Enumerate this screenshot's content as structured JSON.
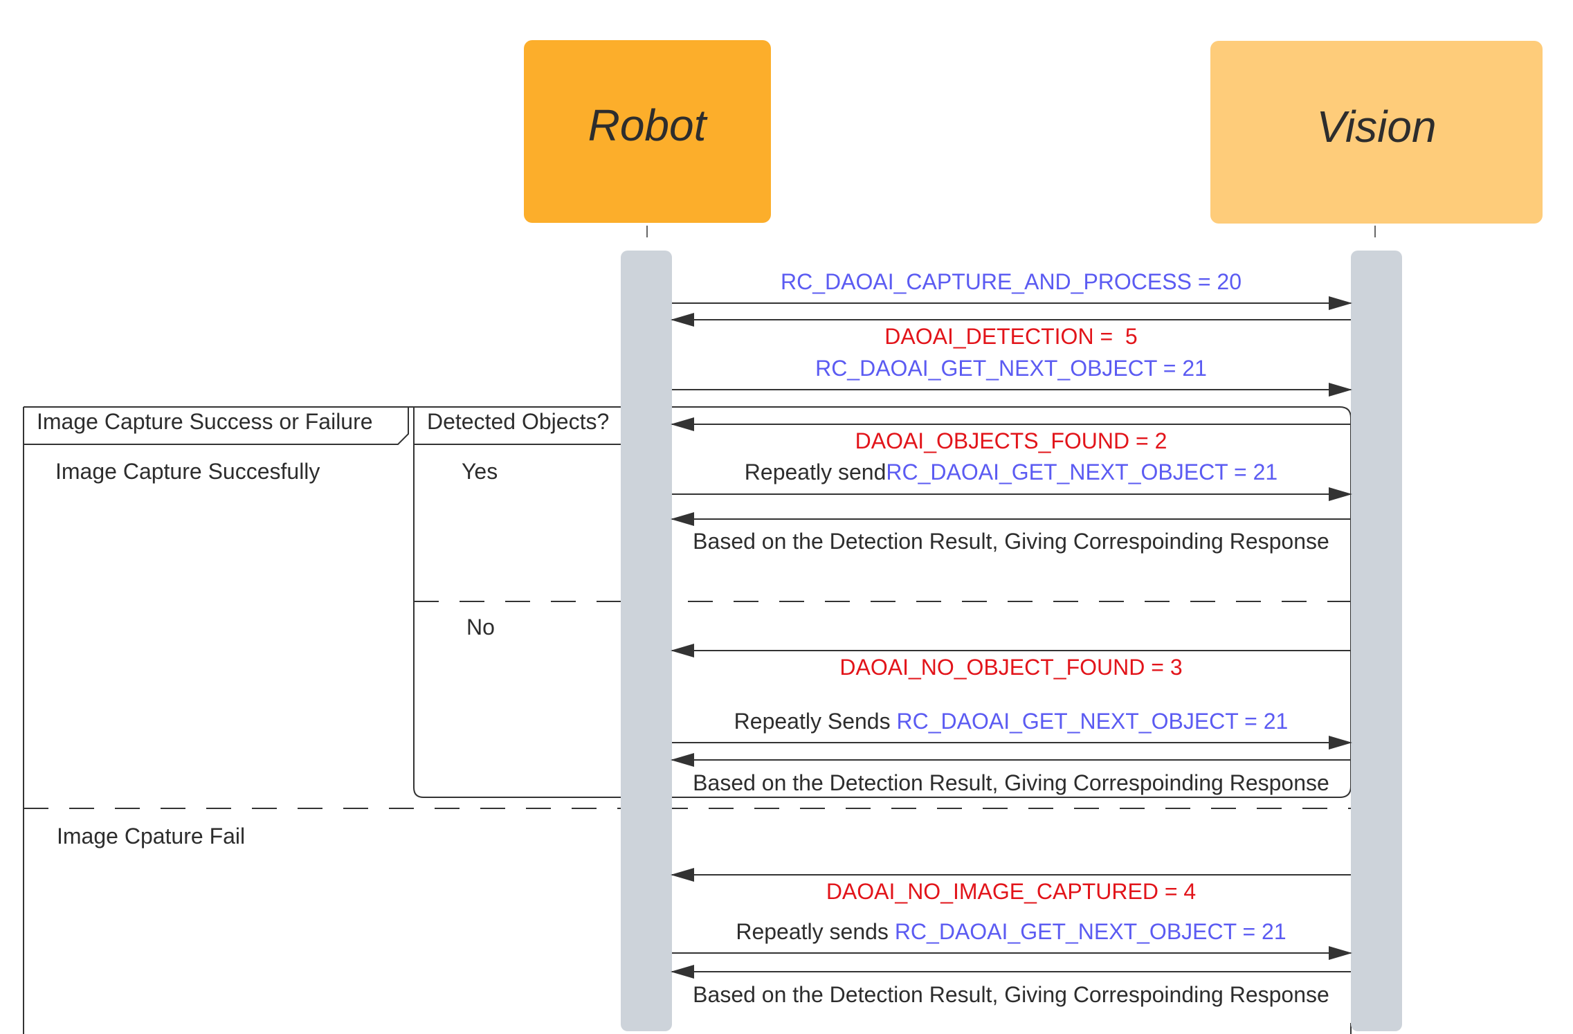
{
  "participants": [
    {
      "name": "Robot",
      "color": "#FCAE2B"
    },
    {
      "name": "Vision",
      "color": "#FECC7A"
    }
  ],
  "colors": {
    "command": "#5B5BF2",
    "response": "#E2141A",
    "text": "#2d2d2d",
    "lifeline": "#CDD3DA",
    "frame": "#333333"
  },
  "frames": {
    "outer": {
      "label": "Image Capture Success or Failure",
      "sections": [
        "Image Capture Succesfully",
        "Image Cpature Fail"
      ]
    },
    "inner": {
      "label": "Detected Objects?",
      "sections": [
        "Yes",
        "No"
      ]
    }
  },
  "messages": {
    "m1": {
      "command": "RC_DAOAI_CAPTURE_AND_PROCESS = 20"
    },
    "m2": {
      "response": "DAOAI_DETECTION =  5"
    },
    "m3": {
      "command": "RC_DAOAI_GET_NEXT_OBJECT = 21"
    },
    "m4": {
      "response": "DAOAI_OBJECTS_FOUND = 2"
    },
    "m5": {
      "prefix": "Repeatly send",
      "command": "RC_DAOAI_GET_NEXT_OBJECT = 21"
    },
    "m6": {
      "text": "Based on the Detection Result, Giving Correspoinding Response"
    },
    "m7": {
      "response": "DAOAI_NO_OBJECT_FOUND = 3"
    },
    "m8": {
      "prefix": "Repeatly Sends ",
      "command": "RC_DAOAI_GET_NEXT_OBJECT = 21"
    },
    "m9": {
      "text": "Based on the Detection Result, Giving Correspoinding Response"
    },
    "m10": {
      "response": "DAOAI_NO_IMAGE_CAPTURED = 4"
    },
    "m11": {
      "prefix": "Repeatly sends ",
      "command": "RC_DAOAI_GET_NEXT_OBJECT = 21"
    },
    "m12": {
      "text": "Based on the Detection Result, Giving Correspoinding Response"
    }
  }
}
